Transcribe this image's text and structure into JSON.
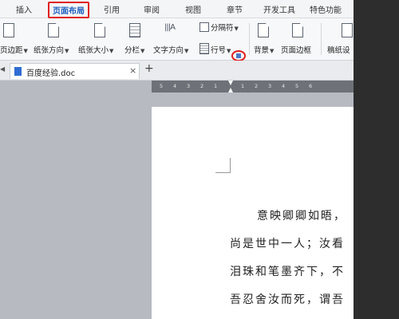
{
  "tabs": [
    {
      "label": "插入"
    },
    {
      "label": "页面布局"
    },
    {
      "label": "引用"
    },
    {
      "label": "审阅"
    },
    {
      "label": "视图"
    },
    {
      "label": "章节"
    },
    {
      "label": "开发工具"
    },
    {
      "label": "特色功能"
    }
  ],
  "ribbon": {
    "margins": "页边距",
    "orientation": "纸张方向",
    "size": "纸张大小",
    "columns": "分栏",
    "text_direction": "文字方向",
    "separator": "分隔符",
    "line_number": "行号",
    "background": "背景",
    "page_border": "页面边框",
    "grid": "稿纸设"
  },
  "document": {
    "tab_name": "百度经验.doc",
    "close": "×",
    "add": "+"
  },
  "ruler": {
    "numbers": [
      "5",
      "4",
      "3",
      "2",
      "1",
      "",
      "1",
      "2",
      "3",
      "4",
      "5",
      "6"
    ]
  },
  "page": {
    "lines": [
      "意映卿卿如晤，",
      "尚是世中一人；汝看",
      "泪珠和笔墨齐下，不",
      "吾忍舍汝而死，谓吾"
    ]
  },
  "colors": {
    "accent": "#1f5fbf",
    "highlight": "#e0201f"
  }
}
